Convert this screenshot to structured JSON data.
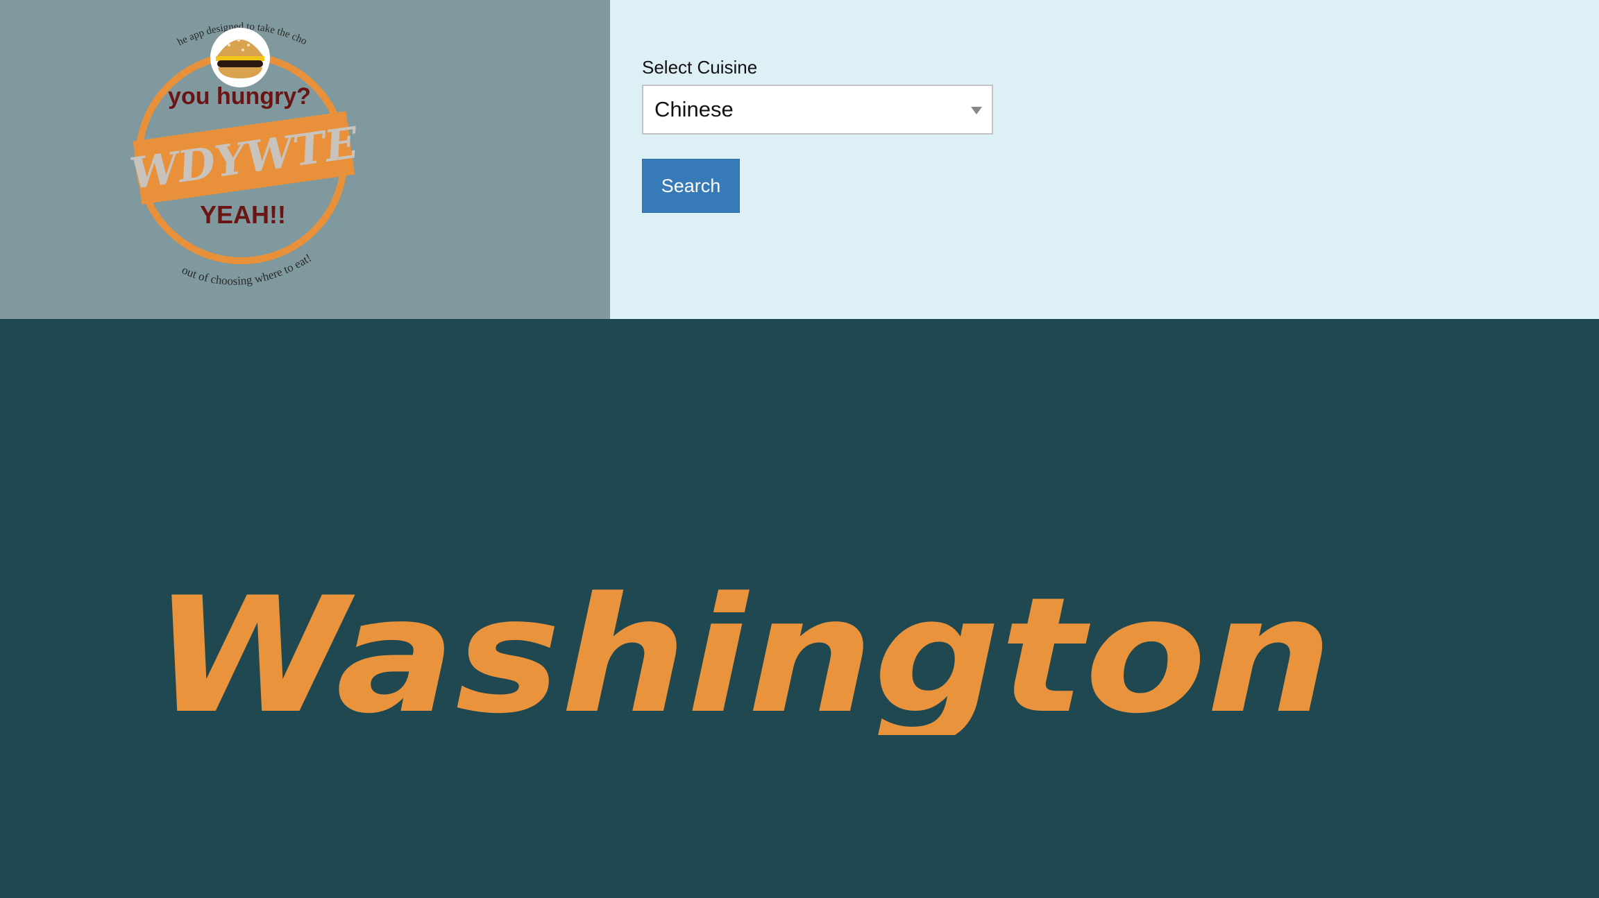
{
  "logo": {
    "top_text": "The app designed to take the chore",
    "line1": "you hungry?",
    "band": "WDYWTE",
    "line2": "YEAH!!",
    "bottom_text": "out of choosing where to eat!",
    "orange": "#e8913a",
    "dark_red": "#6b1414",
    "icon": "burger-icon"
  },
  "form": {
    "label": "Select Cuisine",
    "selected": "Chinese",
    "search_label": "Search",
    "button_color": "#377ab8"
  },
  "hero": {
    "city": "Washington",
    "color": "#ea933d",
    "background": "#1f4850"
  }
}
